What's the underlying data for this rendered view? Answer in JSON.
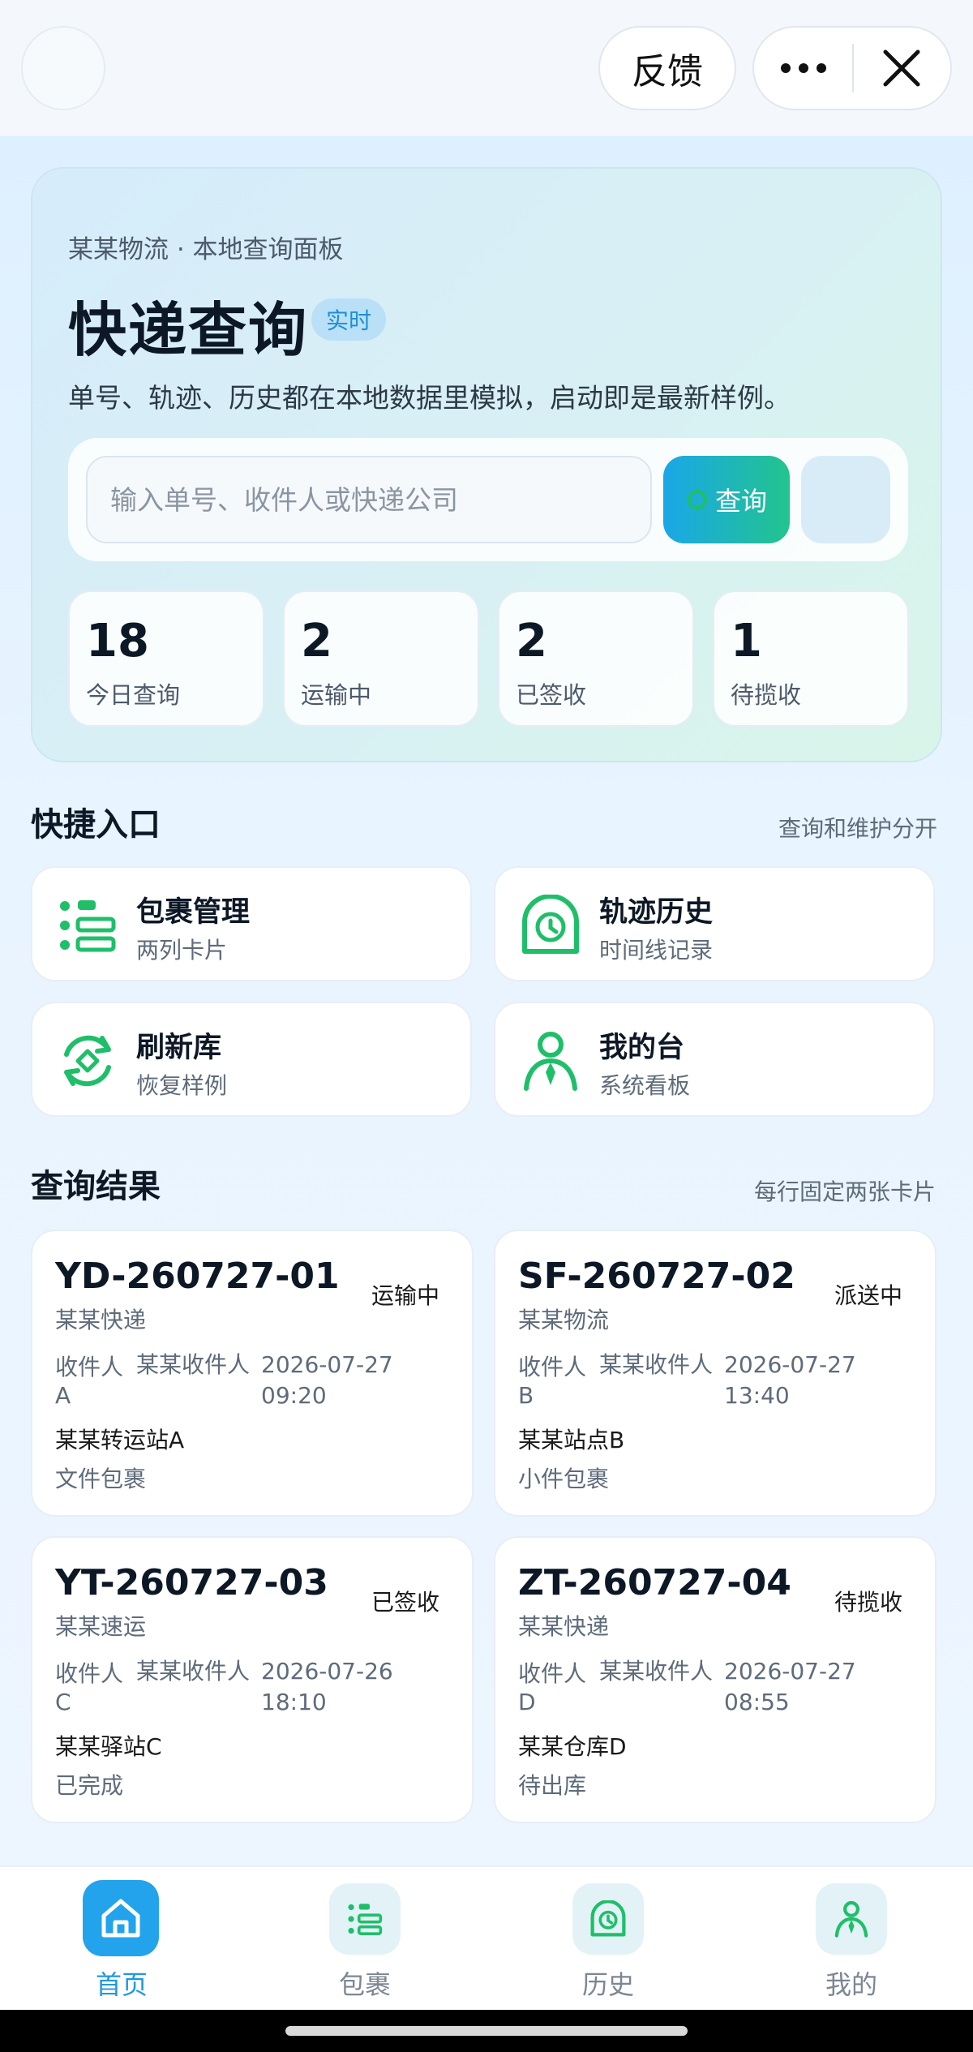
{
  "topbar": {
    "feedback_label": "反馈"
  },
  "hero": {
    "subtitle": "某某物流 · 本地查询面板",
    "title": "快递查询",
    "badge": "实时",
    "description": "单号、轨迹、历史都在本地数据里模拟，启动即是最新样例。",
    "search": {
      "placeholder": "输入单号、收件人或快递公司",
      "button_label": "查询"
    },
    "stats": [
      {
        "value": "18",
        "label": "今日查询"
      },
      {
        "value": "2",
        "label": "运输中"
      },
      {
        "value": "2",
        "label": "已签收"
      },
      {
        "value": "1",
        "label": "待揽收"
      }
    ]
  },
  "quick": {
    "title": "快捷入口",
    "note": "查询和维护分开",
    "items": [
      {
        "title": "包裹管理",
        "subtitle": "两列卡片",
        "icon": "list-icon"
      },
      {
        "title": "轨迹历史",
        "subtitle": "时间线记录",
        "icon": "clock-icon"
      },
      {
        "title": "刷新库",
        "subtitle": "恢复样例",
        "icon": "refresh-icon"
      },
      {
        "title": "我的台",
        "subtitle": "系统看板",
        "icon": "person-icon"
      }
    ]
  },
  "results": {
    "title": "查询结果",
    "note": "每行固定两张卡片",
    "items": [
      {
        "no": "YD-260727-01",
        "status": "运输中",
        "company": "某某快递",
        "receiver_label": "收件人",
        "receiver_a": "某某收件人",
        "receiver_b": "A",
        "date": "2026-07-27",
        "time": "09:20",
        "location": "某某转运站A",
        "kind": "文件包裹"
      },
      {
        "no": "SF-260727-02",
        "status": "派送中",
        "company": "某某物流",
        "receiver_label": "收件人",
        "receiver_a": "某某收件人",
        "receiver_b": "B",
        "date": "2026-07-27",
        "time": "13:40",
        "location": "某某站点B",
        "kind": "小件包裹"
      },
      {
        "no": "YT-260727-03",
        "status": "已签收",
        "company": "某某速运",
        "receiver_label": "收件人",
        "receiver_a": "某某收件人",
        "receiver_b": "C",
        "date": "2026-07-26",
        "time": "18:10",
        "location": "某某驿站C",
        "kind": "已完成"
      },
      {
        "no": "ZT-260727-04",
        "status": "待揽收",
        "company": "某某快递",
        "receiver_label": "收件人",
        "receiver_a": "某某收件人",
        "receiver_b": "D",
        "date": "2026-07-27",
        "time": "08:55",
        "location": "某某仓库D",
        "kind": "待出库"
      }
    ]
  },
  "nav": {
    "items": [
      {
        "label": "首页",
        "icon": "home-icon",
        "active": true
      },
      {
        "label": "包裹",
        "icon": "list-icon",
        "active": false
      },
      {
        "label": "历史",
        "icon": "clock-icon",
        "active": false
      },
      {
        "label": "我的",
        "icon": "person-icon",
        "active": false
      }
    ]
  },
  "colors": {
    "accent_blue": "#22a3ec",
    "accent_green": "#22c48e",
    "icon_green": "#1fbf6a"
  }
}
